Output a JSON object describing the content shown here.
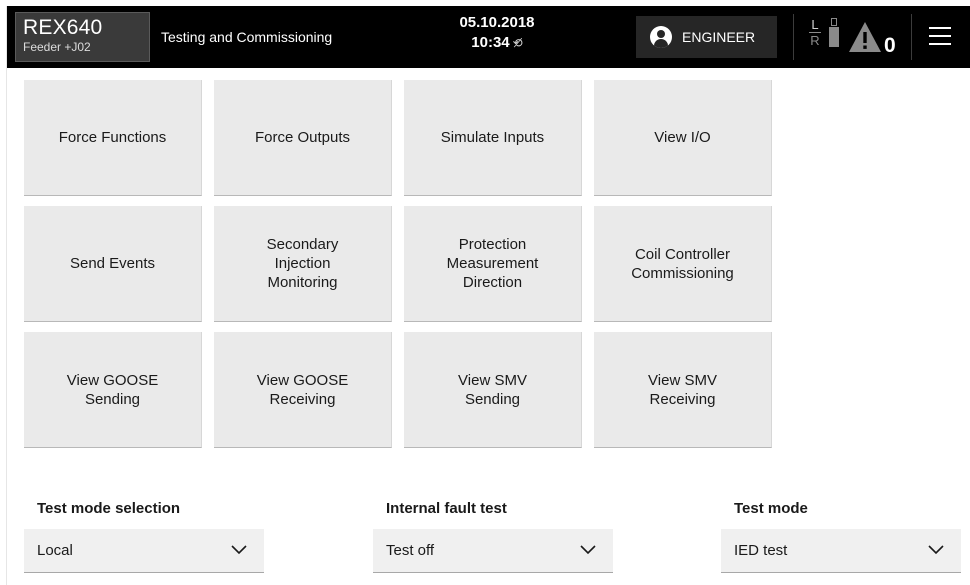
{
  "header": {
    "device_name": "REX640",
    "device_location": "Feeder +J02",
    "app_title": "Testing and Commissioning",
    "date": "05.10.2018",
    "time": "10:34",
    "user": "ENGINEER",
    "local_indicator": "L",
    "remote_indicator": "R",
    "warning_count": "0"
  },
  "tiles": [
    "Force Functions",
    "Force Outputs",
    "Simulate Inputs",
    "View I/O",
    "Send Events",
    "Secondary\nInjection\nMonitoring",
    "Protection\nMeasurement\nDirection",
    "Coil Controller\nCommissioning",
    "View GOOSE\nSending",
    "View GOOSE\nReceiving",
    "View SMV\nSending",
    "View SMV\nReceiving"
  ],
  "selectors": {
    "test_mode_selection": {
      "label": "Test mode selection",
      "value": "Local"
    },
    "internal_fault_test": {
      "label": "Internal fault test",
      "value": "Test off"
    },
    "test_mode": {
      "label": "Test mode",
      "value": "IED test"
    }
  },
  "icons": {
    "user": "user-icon",
    "sync": "sync-off-icon",
    "usb": "usb-icon",
    "warning": "warning-icon",
    "menu": "hamburger-menu-icon",
    "dropdown": "chevron-down-icon"
  },
  "colors": {
    "header_bg": "#000000",
    "tile_bg": "#eaeaea",
    "select_bg": "#f0f0f0"
  }
}
